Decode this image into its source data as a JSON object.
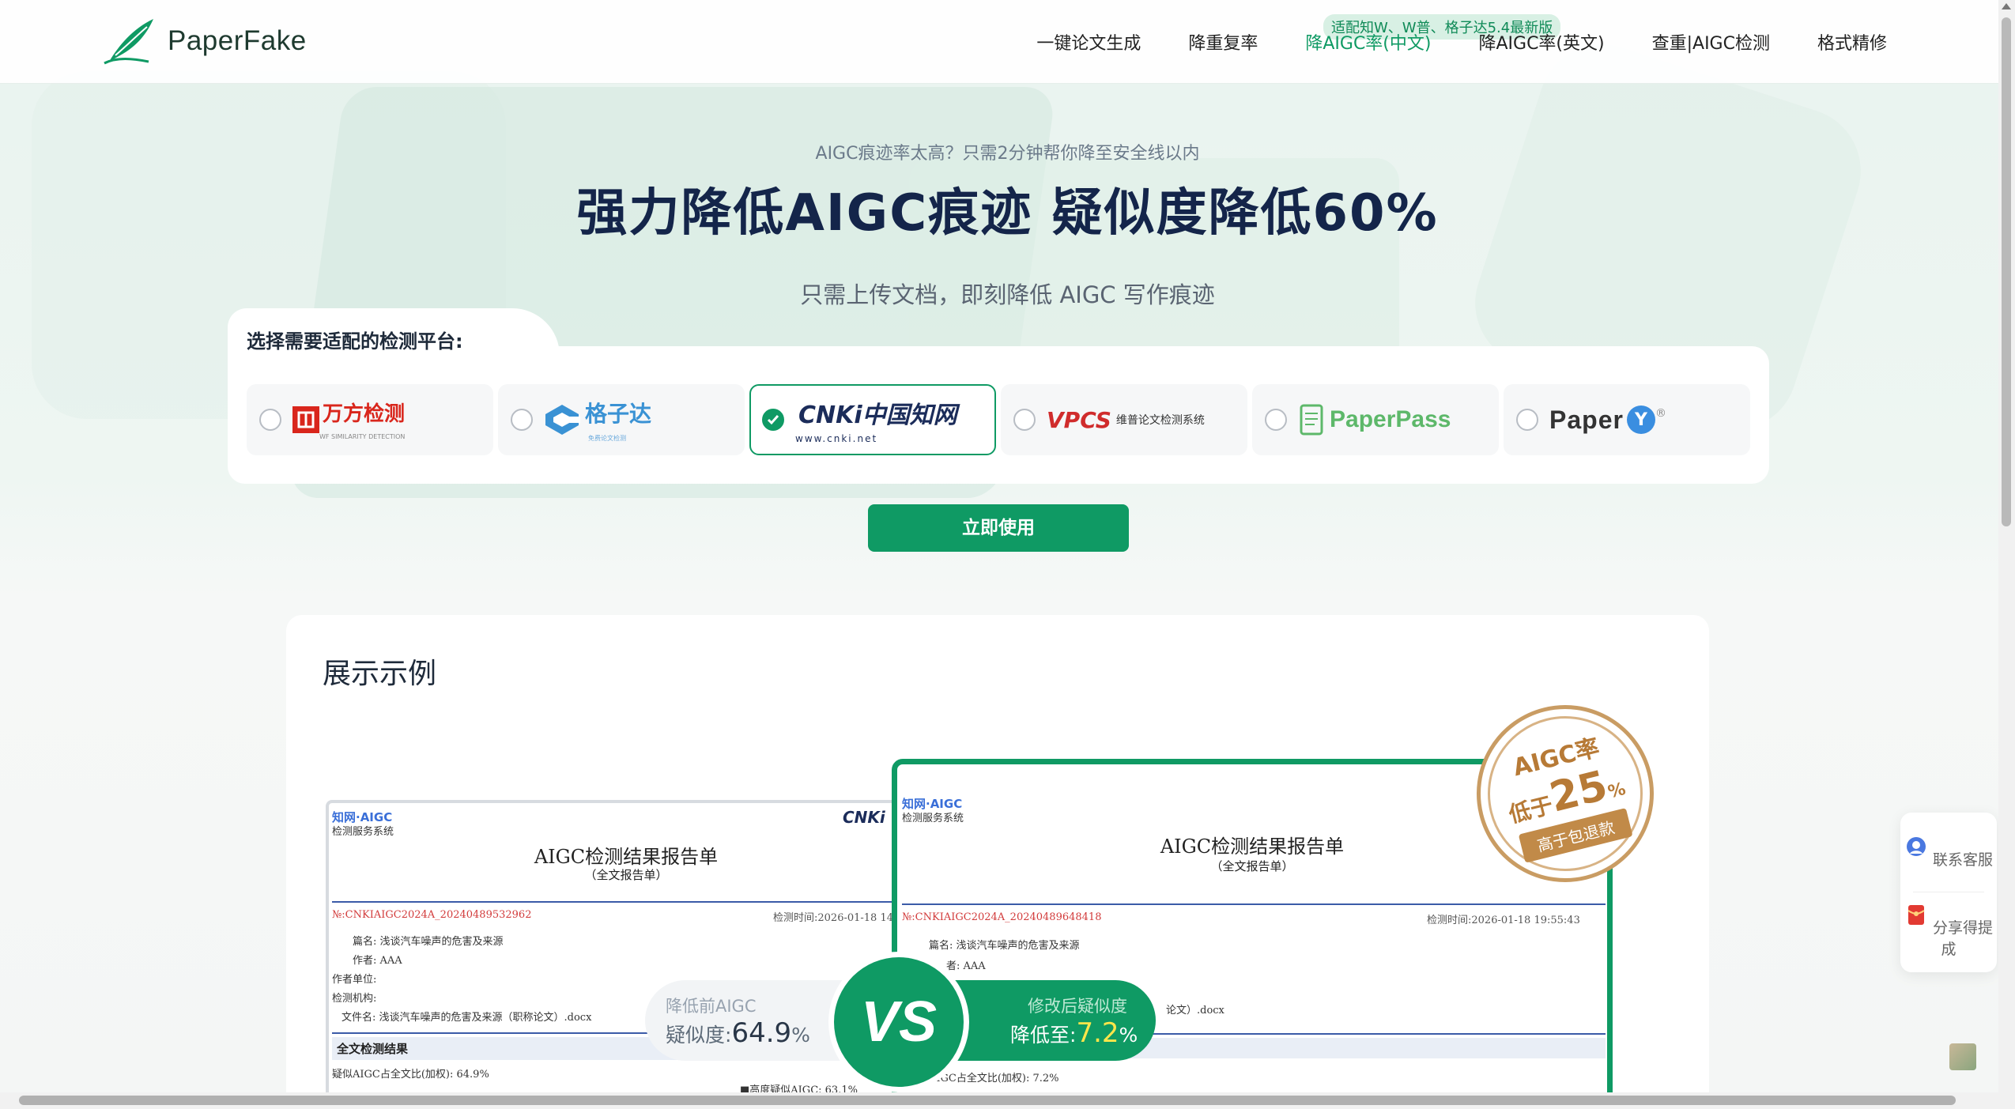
{
  "brand": {
    "name": "PaperFake"
  },
  "nav": {
    "items": [
      {
        "label": "一键论文生成",
        "active": false
      },
      {
        "label": "降重复率",
        "active": false
      },
      {
        "label": "降AIGC率(中文)",
        "active": true
      },
      {
        "label": "降AIGC率(英文)",
        "active": false
      },
      {
        "label": "查重|AIGC检测",
        "active": false
      },
      {
        "label": "格式精修",
        "active": false
      }
    ],
    "badge": "适配知W、W普、格子达5.4最新版"
  },
  "hero": {
    "subtitle": "AIGC痕迹率太高？只需2分钟帮你降至安全线以内",
    "title": "强力降低AIGC痕迹 疑似度降低60%",
    "description": "只需上传文档，即刻降低 AIGC 写作痕迹"
  },
  "platform_select": {
    "label": "选择需要适配的检测平台:",
    "selected": "cnki",
    "platforms": [
      {
        "id": "wanfang",
        "name": "万方检测",
        "tagline": "WF SIMILARITY DETECTION"
      },
      {
        "id": "gezida",
        "name": "格子达",
        "tagline": "免费论文检测"
      },
      {
        "id": "cnki",
        "name": "CNKi中国知网",
        "tagline": "www.cnki.net"
      },
      {
        "id": "vpcs",
        "name": "VPCS",
        "tagline": "维普论文检测系统"
      },
      {
        "id": "paperpass",
        "name": "PaperPass",
        "tagline": ""
      },
      {
        "id": "paperyy",
        "name": "Paper",
        "tagline": ""
      }
    ],
    "button_label": "立即使用"
  },
  "showcase": {
    "title": "展示示例",
    "left_report": {
      "brand": "知网·AIGC",
      "brand_sub": "检测服务系统",
      "title": "AIGC检测结果报告单",
      "subtitle": "（全文报告单）",
      "number": "№:CNKIAIGC2024A_20240489532962",
      "time": "检测时间:2026-01-18 14",
      "fields": [
        "篇名: 浅谈汽车噪声的危害及来源",
        "作者: AAA",
        "作者单位:",
        "检测机构:",
        "文件名: 浅谈汽车噪声的危害及来源（职称论文）.docx"
      ],
      "section": "全文检测结果",
      "result_line": "疑似AIGC占全文比(加权): 64.9%",
      "high_line": "■高度疑似AIGC: 63.1%"
    },
    "right_report": {
      "brand": "知网·AIGC",
      "brand_sub": "检测服务系统",
      "title": "AIGC检测结果报告单",
      "subtitle": "（全文报告单）",
      "number": "№:CNKIAIGC2024A_20240489648418",
      "time": "检测时间:2026-01-18 19:55:43",
      "fields": [
        "篇名: 浅谈汽车噪声的危害及来源",
        "者: AAA",
        "论文）.docx"
      ],
      "result_line": "AIGC占全文比(加权): 7.2%"
    },
    "before": {
      "label": "降低前AIGC",
      "prefix": "疑似度:",
      "value": "64.9",
      "unit": "%"
    },
    "after": {
      "label": "修改后疑似度",
      "prefix": "降低至:",
      "value": "7.2",
      "unit": "%"
    },
    "vs": "VS",
    "seal": {
      "line1": "AIGC率",
      "line2_prefix": "低于",
      "line2_value": "25",
      "line2_unit": "%",
      "ribbon": "高于包退款"
    }
  },
  "side_bar": {
    "items": [
      {
        "label": "联系客服",
        "icon": "headset-icon"
      },
      {
        "label": "分享得提成",
        "icon": "red-envelope-icon"
      }
    ]
  },
  "colors": {
    "accent": "#0f9a64",
    "title": "#14254a",
    "seal": "#b77a36"
  }
}
